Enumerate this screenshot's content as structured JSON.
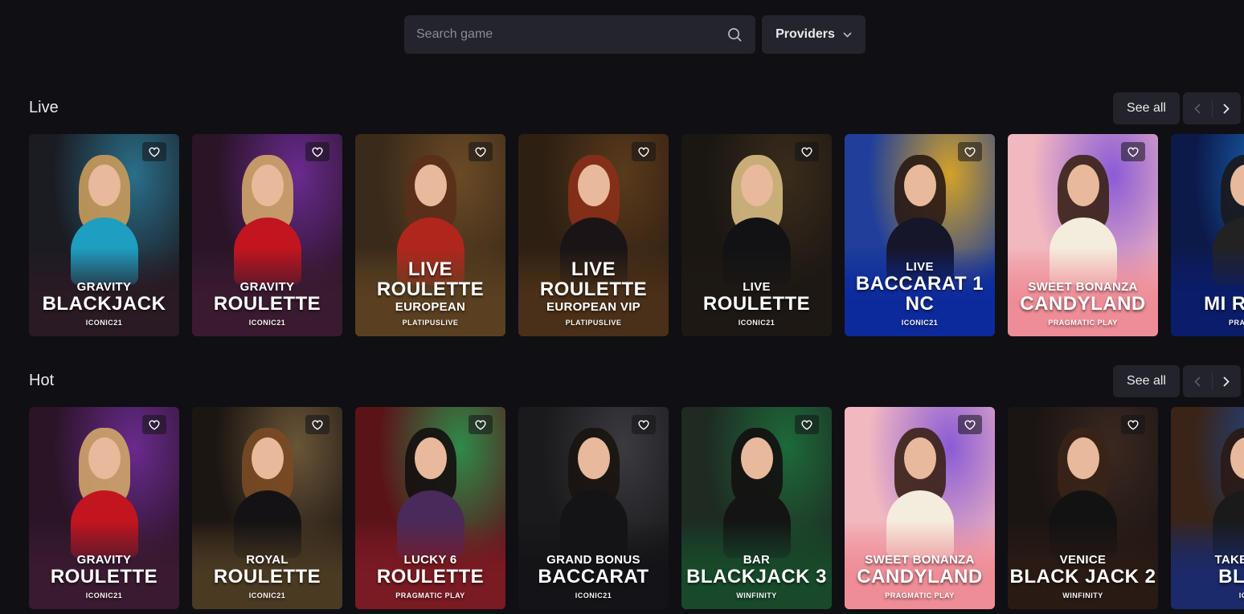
{
  "search": {
    "placeholder": "Search game"
  },
  "providers": {
    "label": "Providers"
  },
  "sections": [
    {
      "title": "Live",
      "see_all": "See all",
      "games": [
        {
          "sub": "GRAVITY",
          "main": "BLACKJACK",
          "extra": "",
          "provider": "ICONIC21",
          "bg": "#1b1b22",
          "accent": "#2a6f8a",
          "fade": "#2a1a24",
          "hair": "#c99b5b",
          "outfit": "#1e9ec0"
        },
        {
          "sub": "GRAVITY",
          "main": "ROULETTE",
          "extra": "",
          "provider": "ICONIC21",
          "bg": "#2a1426",
          "accent": "#6a2a8f",
          "fade": "#3a1a30",
          "hair": "#d2a66a",
          "outfit": "#c2151f"
        },
        {
          "sub": "",
          "main": "LIVE ROULETTE",
          "extra": "EUROPEAN",
          "provider": "PLATIPUSLIVE",
          "bg": "#3a2a1a",
          "accent": "#6b4a25",
          "fade": "#5a4020",
          "hair": "#5a2f1a",
          "outfit": "#b0261d"
        },
        {
          "sub": "",
          "main": "LIVE ROULETTE",
          "extra": "EUROPEAN VIP",
          "provider": "PLATIPUSLIVE",
          "bg": "#2d1f12",
          "accent": "#5a3a1c",
          "fade": "#4a3018",
          "hair": "#8a2f1a",
          "outfit": "#1a1416"
        },
        {
          "sub": "LIVE",
          "main": "ROULETTE",
          "extra": "",
          "provider": "ICONIC21",
          "bg": "#1a1612",
          "accent": "#3a2c1c",
          "fade": "#1e1814",
          "hair": "#d9bd82",
          "outfit": "#121214"
        },
        {
          "sub": "LIVE",
          "main": "BACCARAT 1 NC",
          "extra": "",
          "provider": "ICONIC21",
          "bg": "#1f3f9a",
          "accent": "#d4a227",
          "fade": "#0d2a9c",
          "hair": "#2a1a14",
          "outfit": "#15162a"
        },
        {
          "sub": "SWEET BONANZA",
          "main": "CANDYLAND",
          "extra": "",
          "provider": "PRAGMATIC PLAY",
          "bg": "#f2b8c0",
          "accent": "#8a5bd6",
          "fade": "#ee8d97",
          "hair": "#3a2216",
          "outfit": "#f4ecdc"
        },
        {
          "sub": "",
          "main": "MI ROUL",
          "extra": "",
          "provider": "PRAGMA",
          "bg": "#0c1a4a",
          "accent": "#1b6fc5",
          "fade": "#0b1c6a",
          "hair": "#1a1a1a",
          "outfit": "#222"
        }
      ]
    },
    {
      "title": "Hot",
      "see_all": "See all",
      "games": [
        {
          "sub": "GRAVITY",
          "main": "ROULETTE",
          "extra": "",
          "provider": "ICONIC21",
          "bg": "#2a1426",
          "accent": "#6a2a8f",
          "fade": "#3a1a30",
          "hair": "#d2a66a",
          "outfit": "#c2151f"
        },
        {
          "sub": "ROYAL",
          "main": "ROULETTE",
          "extra": "",
          "provider": "ICONIC21",
          "bg": "#1c1612",
          "accent": "#6b5538",
          "fade": "#4a3a22",
          "hair": "#7a4a24",
          "outfit": "#141214"
        },
        {
          "sub": "LUCKY 6",
          "main": "ROULETTE",
          "extra": "",
          "provider": "PRAGMATIC PLAY",
          "bg": "#5a1418",
          "accent": "#2f8a4a",
          "fade": "#7a1a22",
          "hair": "#141010",
          "outfit": "#4a2a5a"
        },
        {
          "sub": "GRAND BONUS",
          "main": "BACCARAT",
          "extra": "",
          "provider": "ICONIC21",
          "bg": "#1a1a1c",
          "accent": "#3a3a40",
          "fade": "#141418",
          "hair": "#1a1410",
          "outfit": "#141416"
        },
        {
          "sub": "BAR",
          "main": "BLACKJACK 3",
          "extra": "",
          "provider": "WINFINITY",
          "bg": "#1e2a22",
          "accent": "#1d6a3a",
          "fade": "#174a2a",
          "hair": "#141010",
          "outfit": "#141414"
        },
        {
          "sub": "SWEET BONANZA",
          "main": "CANDYLAND",
          "extra": "",
          "provider": "PRAGMATIC PLAY",
          "bg": "#f2b8c0",
          "accent": "#8a5bd6",
          "fade": "#ee8d97",
          "hair": "#3a2216",
          "outfit": "#f4ecdc"
        },
        {
          "sub": "VENICE",
          "main": "BLACK JACK 2",
          "extra": "",
          "provider": "WINFINITY",
          "bg": "#1a1412",
          "accent": "#3a2820",
          "fade": "#2a1a14",
          "hair": "#3a2418",
          "outfit": "#121212"
        },
        {
          "sub": "TAKE DEA",
          "main": "BLAC",
          "extra": "",
          "provider": "ICO",
          "bg": "#3a2418",
          "accent": "#1b4a9a",
          "fade": "#1a2a6a",
          "hair": "#2a1a14",
          "outfit": "#1a1a1a"
        }
      ]
    }
  ]
}
